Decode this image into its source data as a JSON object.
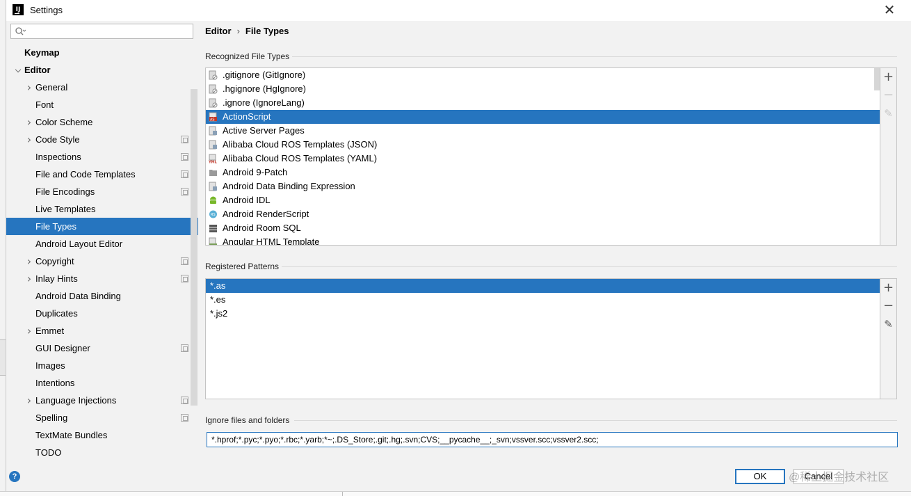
{
  "window": {
    "title": "Settings",
    "app_icon": "intellij-icon",
    "close_icon": "close-icon"
  },
  "sidebar": {
    "search_placeholder": "",
    "items": [
      {
        "label": "Keymap",
        "level": 0,
        "arrow": "",
        "project_icon": false,
        "selected": false
      },
      {
        "label": "Editor",
        "level": 0,
        "arrow": "expanded",
        "project_icon": false,
        "selected": false
      },
      {
        "label": "General",
        "level": 1,
        "arrow": "collapsed",
        "project_icon": false,
        "selected": false
      },
      {
        "label": "Font",
        "level": 1,
        "arrow": "",
        "project_icon": false,
        "selected": false
      },
      {
        "label": "Color Scheme",
        "level": 1,
        "arrow": "collapsed",
        "project_icon": false,
        "selected": false
      },
      {
        "label": "Code Style",
        "level": 1,
        "arrow": "collapsed",
        "project_icon": true,
        "selected": false
      },
      {
        "label": "Inspections",
        "level": 1,
        "arrow": "",
        "project_icon": true,
        "selected": false
      },
      {
        "label": "File and Code Templates",
        "level": 1,
        "arrow": "",
        "project_icon": true,
        "selected": false
      },
      {
        "label": "File Encodings",
        "level": 1,
        "arrow": "",
        "project_icon": true,
        "selected": false
      },
      {
        "label": "Live Templates",
        "level": 1,
        "arrow": "",
        "project_icon": false,
        "selected": false
      },
      {
        "label": "File Types",
        "level": 1,
        "arrow": "",
        "project_icon": false,
        "selected": true
      },
      {
        "label": "Android Layout Editor",
        "level": 1,
        "arrow": "",
        "project_icon": false,
        "selected": false
      },
      {
        "label": "Copyright",
        "level": 1,
        "arrow": "collapsed",
        "project_icon": true,
        "selected": false
      },
      {
        "label": "Inlay Hints",
        "level": 1,
        "arrow": "collapsed",
        "project_icon": true,
        "selected": false
      },
      {
        "label": "Android Data Binding",
        "level": 1,
        "arrow": "",
        "project_icon": false,
        "selected": false
      },
      {
        "label": "Duplicates",
        "level": 1,
        "arrow": "",
        "project_icon": false,
        "selected": false
      },
      {
        "label": "Emmet",
        "level": 1,
        "arrow": "collapsed",
        "project_icon": false,
        "selected": false
      },
      {
        "label": "GUI Designer",
        "level": 1,
        "arrow": "",
        "project_icon": true,
        "selected": false
      },
      {
        "label": "Images",
        "level": 1,
        "arrow": "",
        "project_icon": false,
        "selected": false
      },
      {
        "label": "Intentions",
        "level": 1,
        "arrow": "",
        "project_icon": false,
        "selected": false
      },
      {
        "label": "Language Injections",
        "level": 1,
        "arrow": "collapsed",
        "project_icon": true,
        "selected": false
      },
      {
        "label": "Spelling",
        "level": 1,
        "arrow": "",
        "project_icon": true,
        "selected": false
      },
      {
        "label": "TextMate Bundles",
        "level": 1,
        "arrow": "",
        "project_icon": false,
        "selected": false
      },
      {
        "label": "TODO",
        "level": 1,
        "arrow": "",
        "project_icon": false,
        "selected": false
      }
    ]
  },
  "breadcrumb": {
    "parent": "Editor",
    "separator": "›",
    "current": "File Types"
  },
  "recognized": {
    "title": "Recognized File Types",
    "items": [
      {
        "label": ".gitignore (GitIgnore)",
        "icon": "ignore-file-icon",
        "selected": false
      },
      {
        "label": ".hgignore (HgIgnore)",
        "icon": "ignore-file-icon",
        "selected": false
      },
      {
        "label": ".ignore (IgnoreLang)",
        "icon": "ignore-file-icon",
        "selected": false
      },
      {
        "label": "ActionScript",
        "icon": "actionscript-icon",
        "selected": true
      },
      {
        "label": "Active Server Pages",
        "icon": "asp-file-icon",
        "selected": false
      },
      {
        "label": "Alibaba Cloud ROS Templates (JSON)",
        "icon": "json-file-icon",
        "selected": false
      },
      {
        "label": "Alibaba Cloud ROS Templates (YAML)",
        "icon": "yaml-file-icon",
        "selected": false
      },
      {
        "label": "Android 9-Patch",
        "icon": "folder-icon",
        "selected": false
      },
      {
        "label": "Android Data Binding Expression",
        "icon": "databinding-file-icon",
        "selected": false
      },
      {
        "label": "Android IDL",
        "icon": "android-icon",
        "selected": false
      },
      {
        "label": "Android RenderScript",
        "icon": "renderscript-icon",
        "selected": false
      },
      {
        "label": "Android Room SQL",
        "icon": "database-icon",
        "selected": false
      },
      {
        "label": "Angular HTML Template",
        "icon": "html-file-icon",
        "selected": false
      }
    ]
  },
  "patterns": {
    "title": "Registered Patterns",
    "items": [
      {
        "label": "*.as",
        "selected": true
      },
      {
        "label": "*.es",
        "selected": false
      },
      {
        "label": "*.js2",
        "selected": false
      }
    ]
  },
  "toolbar": {
    "add": "+",
    "remove": "−",
    "edit": "✎"
  },
  "ignore": {
    "title": "Ignore files and folders",
    "value": "*.hprof;*.pyc;*.pyo;*.rbc;*.yarb;*~;.DS_Store;.git;.hg;.svn;CVS;__pycache__;_svn;vssver.scc;vssver2.scc;"
  },
  "footer": {
    "help": "?",
    "ok": "OK",
    "cancel": "Cancel",
    "watermark": "@稀土掘金技术社区"
  },
  "colors": {
    "accent": "#2675bf",
    "background": "#f2f2f2"
  }
}
